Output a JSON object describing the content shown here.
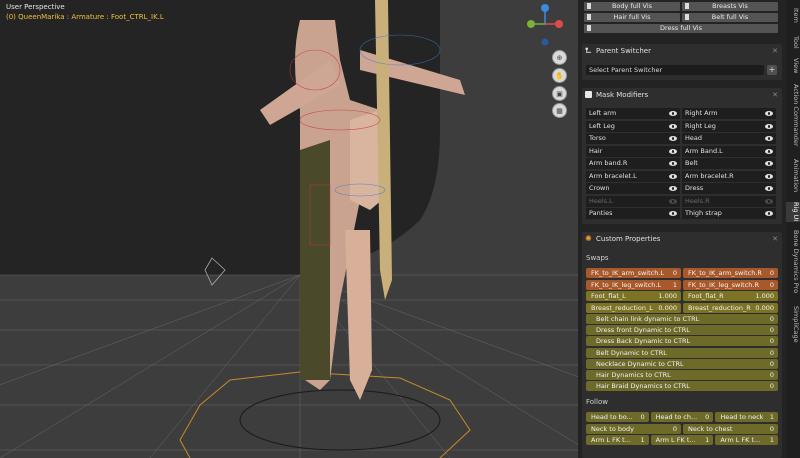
{
  "viewport": {
    "title": "User Perspective",
    "subtitle": "(0) QueenMarika : Armature : Foot_CTRL_IK.L",
    "gizmo": {
      "x_label": "X",
      "y_label": "Y",
      "z_label": "Z"
    }
  },
  "vis_buttons": [
    [
      "Body full Vis",
      "Breasts Vis"
    ],
    [
      "Hair full Vis",
      "Belt full Vis"
    ],
    [
      "Dress full Vis"
    ]
  ],
  "parent_switcher": {
    "title": "Parent Switcher",
    "select_label": "Select Parent Switcher",
    "add_label": "+"
  },
  "mask_modifiers": {
    "title": "Mask Modifiers",
    "rows": [
      [
        "Left arm",
        "Right Arm"
      ],
      [
        "Left Leg",
        "Right Leg"
      ],
      [
        "Torso",
        "Head"
      ],
      [
        "Hair",
        "Arm Band.L"
      ],
      [
        "Arm band.R",
        "Belt"
      ],
      [
        "Arm bracelet.L",
        "Arm bracelet.R"
      ],
      [
        "Crown",
        "Dress"
      ],
      [
        "Heels.L",
        "Heels.R"
      ],
      [
        "Panties",
        "Thigh strap"
      ]
    ]
  },
  "custom_properties": {
    "title": "Custom Properties",
    "swaps_label": "Swaps",
    "swaps": [
      [
        {
          "label": "FK_to_IK_arm_switch.L",
          "value": "0"
        },
        {
          "label": "FK_to_IK_arm_switch.R",
          "value": "0"
        }
      ],
      [
        {
          "label": "FK_to_IK_leg_switch.L",
          "value": "1"
        },
        {
          "label": "FK_to_IK_leg_switch.R",
          "value": "0"
        }
      ],
      [
        {
          "label": "Foot_flat_L",
          "value": "1.000"
        },
        {
          "label": "Foot_flat_R",
          "value": "1.000"
        }
      ],
      [
        {
          "label": "Breast_reduction_L",
          "value": "0.000"
        },
        {
          "label": "Breast_reduction_R",
          "value": "0.000"
        }
      ]
    ],
    "dynamics": [
      {
        "label": "Belt chain link dynamic to CTRL",
        "value": "0"
      },
      {
        "label": "Dress front Dynamic to CTRL",
        "value": "0"
      },
      {
        "label": "Dress Back Dynamic to CTRL",
        "value": "0"
      },
      {
        "label": "Belt Dynamic to CTRL",
        "value": "0"
      },
      {
        "label": "Necklace Dynamic to CTRL",
        "value": "0"
      },
      {
        "label": "Hair Dynamics to CTRL",
        "value": "0"
      },
      {
        "label": "Hair Braid Dynamics to CTRL",
        "value": "0"
      }
    ],
    "follow_label": "Follow",
    "follow": [
      [
        {
          "label": "Head to bo...",
          "value": "0"
        },
        {
          "label": "Head to ch...",
          "value": "0"
        },
        {
          "label": "Head to neck",
          "value": "1"
        }
      ],
      [
        {
          "label": "Neck to body",
          "value": "0"
        },
        {
          "label": "Neck to chest",
          "value": "0"
        }
      ],
      [
        {
          "label": "Arm L FK t...",
          "value": "1"
        },
        {
          "label": "Arm L FK t...",
          "value": "1"
        },
        {
          "label": "Arm L FK t...",
          "value": "1"
        }
      ]
    ]
  },
  "side_tabs": [
    "Item",
    "Tool",
    "View",
    "Action Commander",
    "Animation",
    "Rig UI",
    "Bone Dynamics Pro",
    "SimpliCage"
  ],
  "active_tab": "Rig UI",
  "colors": {
    "swap_orange": "#a8592c",
    "olive": "#7d7324",
    "panel_bg": "#232323",
    "viewport_bg": "#3d3d3d"
  }
}
